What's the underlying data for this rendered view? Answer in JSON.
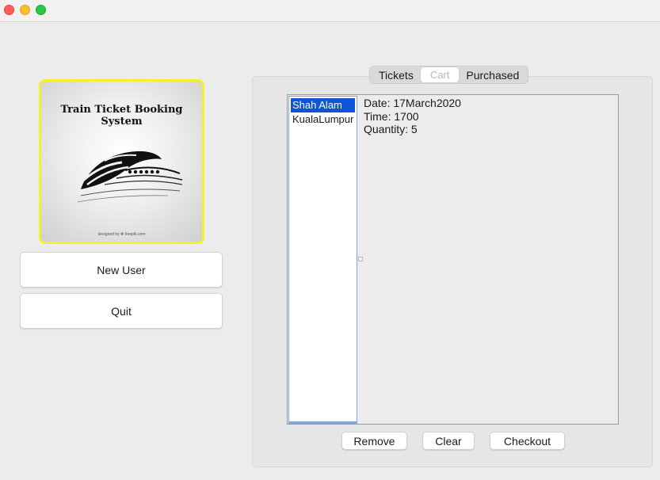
{
  "logo": {
    "title": "Train Ticket Booking System",
    "credit": "designed by ❁ freepik.com"
  },
  "sidebar": {
    "new_user_label": "New User",
    "quit_label": "Quit"
  },
  "tabs": [
    {
      "label": "Tickets",
      "selected": false
    },
    {
      "label": "Cart",
      "selected": true
    },
    {
      "label": "Purchased",
      "selected": false
    }
  ],
  "cart": {
    "items": [
      {
        "label": "Shah Alam",
        "selected": true
      },
      {
        "label": "KualaLumpur",
        "selected": false
      }
    ],
    "details": {
      "date": "Date: 17March2020",
      "time": "Time: 1700",
      "quantity": "Quantity: 5"
    }
  },
  "actions": {
    "remove_label": "Remove",
    "clear_label": "Clear",
    "checkout_label": "Checkout"
  },
  "colors": {
    "logo_border": "#f6f02a",
    "selection": "#0f53d6"
  }
}
